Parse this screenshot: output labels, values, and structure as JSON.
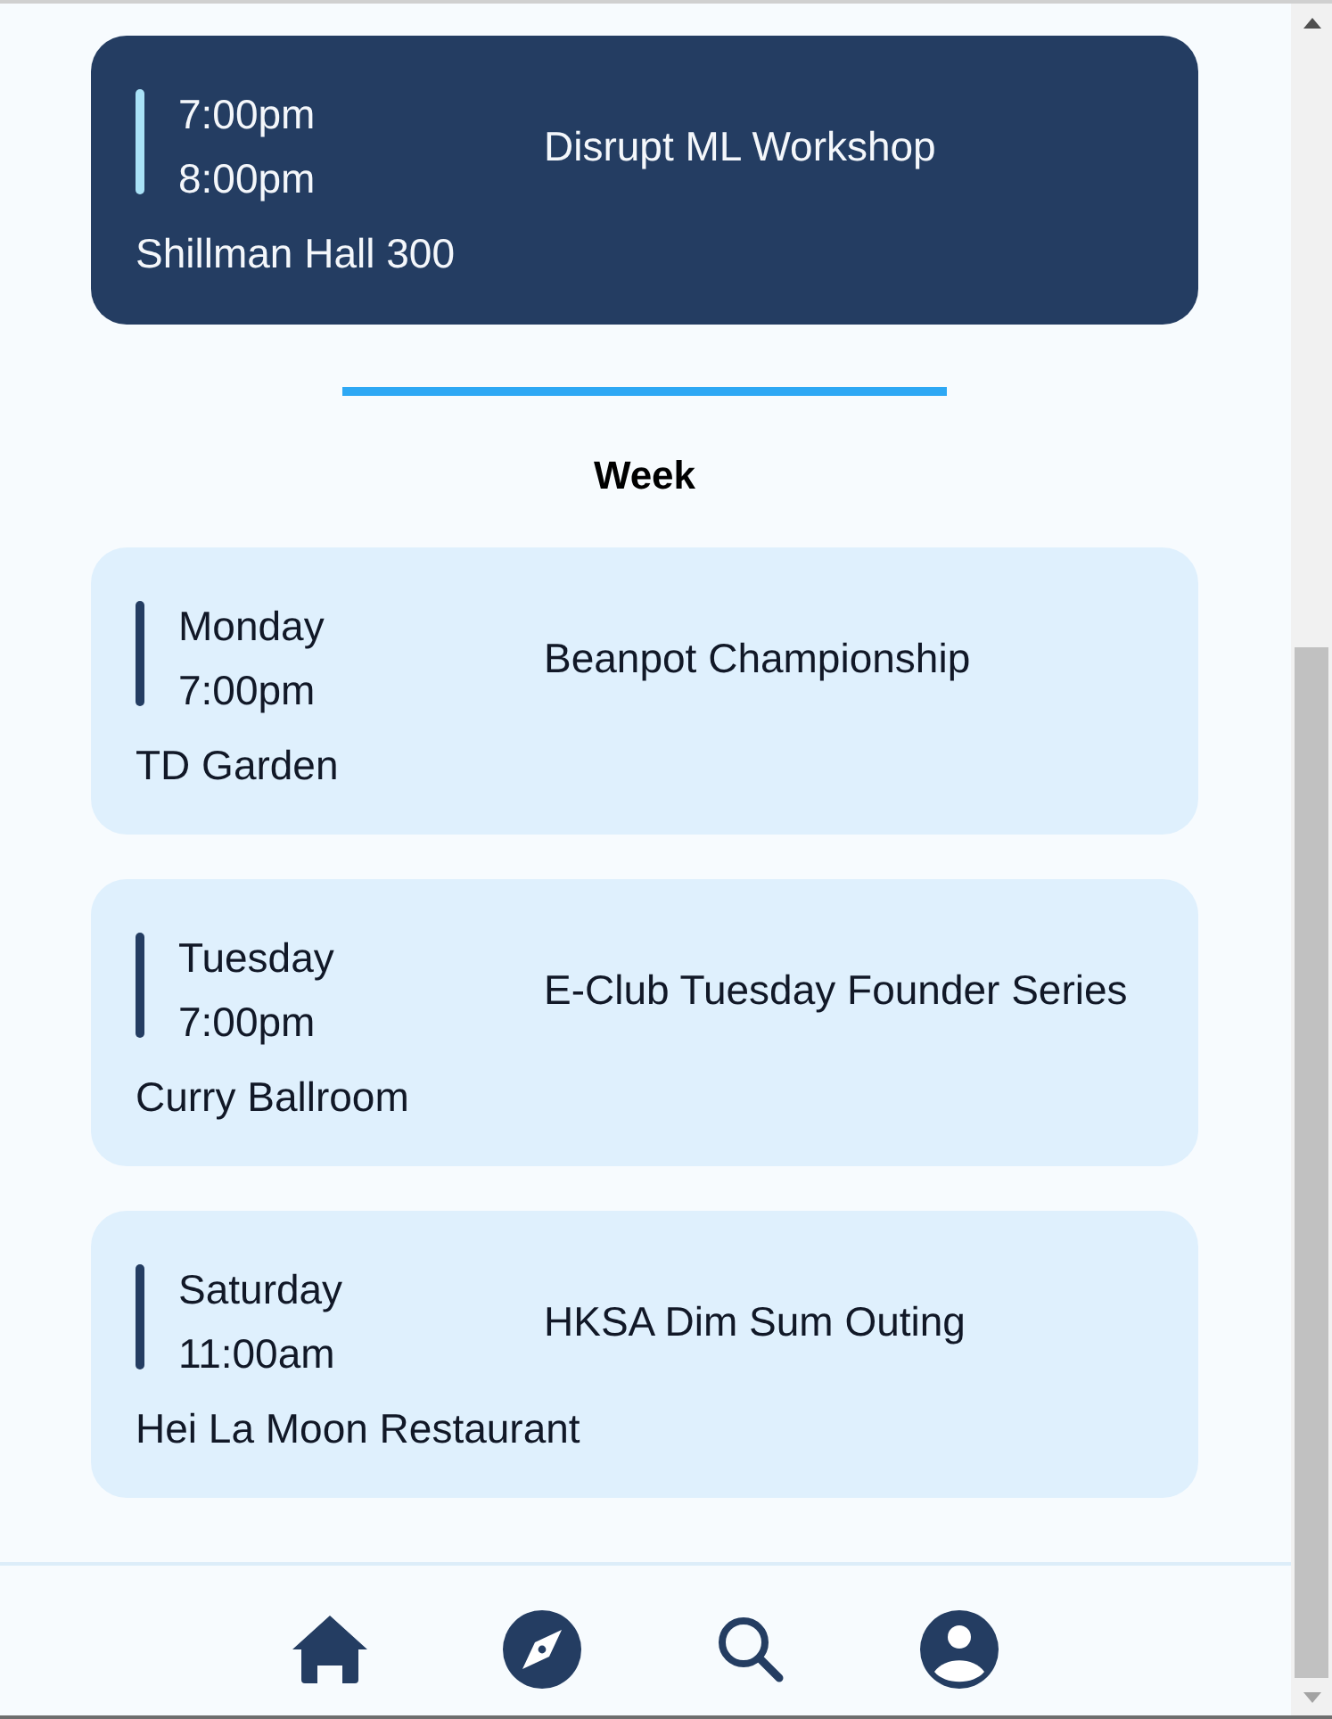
{
  "sections": [
    {
      "events": [
        {
          "highlighted": true,
          "times": [
            "7:00pm",
            "8:00pm"
          ],
          "title": "Disrupt ML Workshop",
          "location": "Shillman Hall 300"
        }
      ]
    },
    {
      "heading": "Week",
      "events": [
        {
          "highlighted": false,
          "times": [
            "Monday",
            "7:00pm"
          ],
          "title": "Beanpot Championship",
          "location": "TD Garden"
        },
        {
          "highlighted": false,
          "times": [
            "Tuesday",
            "7:00pm"
          ],
          "title": "E-Club Tuesday Founder Series",
          "location": "Curry Ballroom"
        },
        {
          "highlighted": false,
          "times": [
            "Saturday",
            "11:00am"
          ],
          "title": "HKSA Dim Sum Outing",
          "location": "Hei La Moon Restaurant"
        }
      ]
    }
  ]
}
